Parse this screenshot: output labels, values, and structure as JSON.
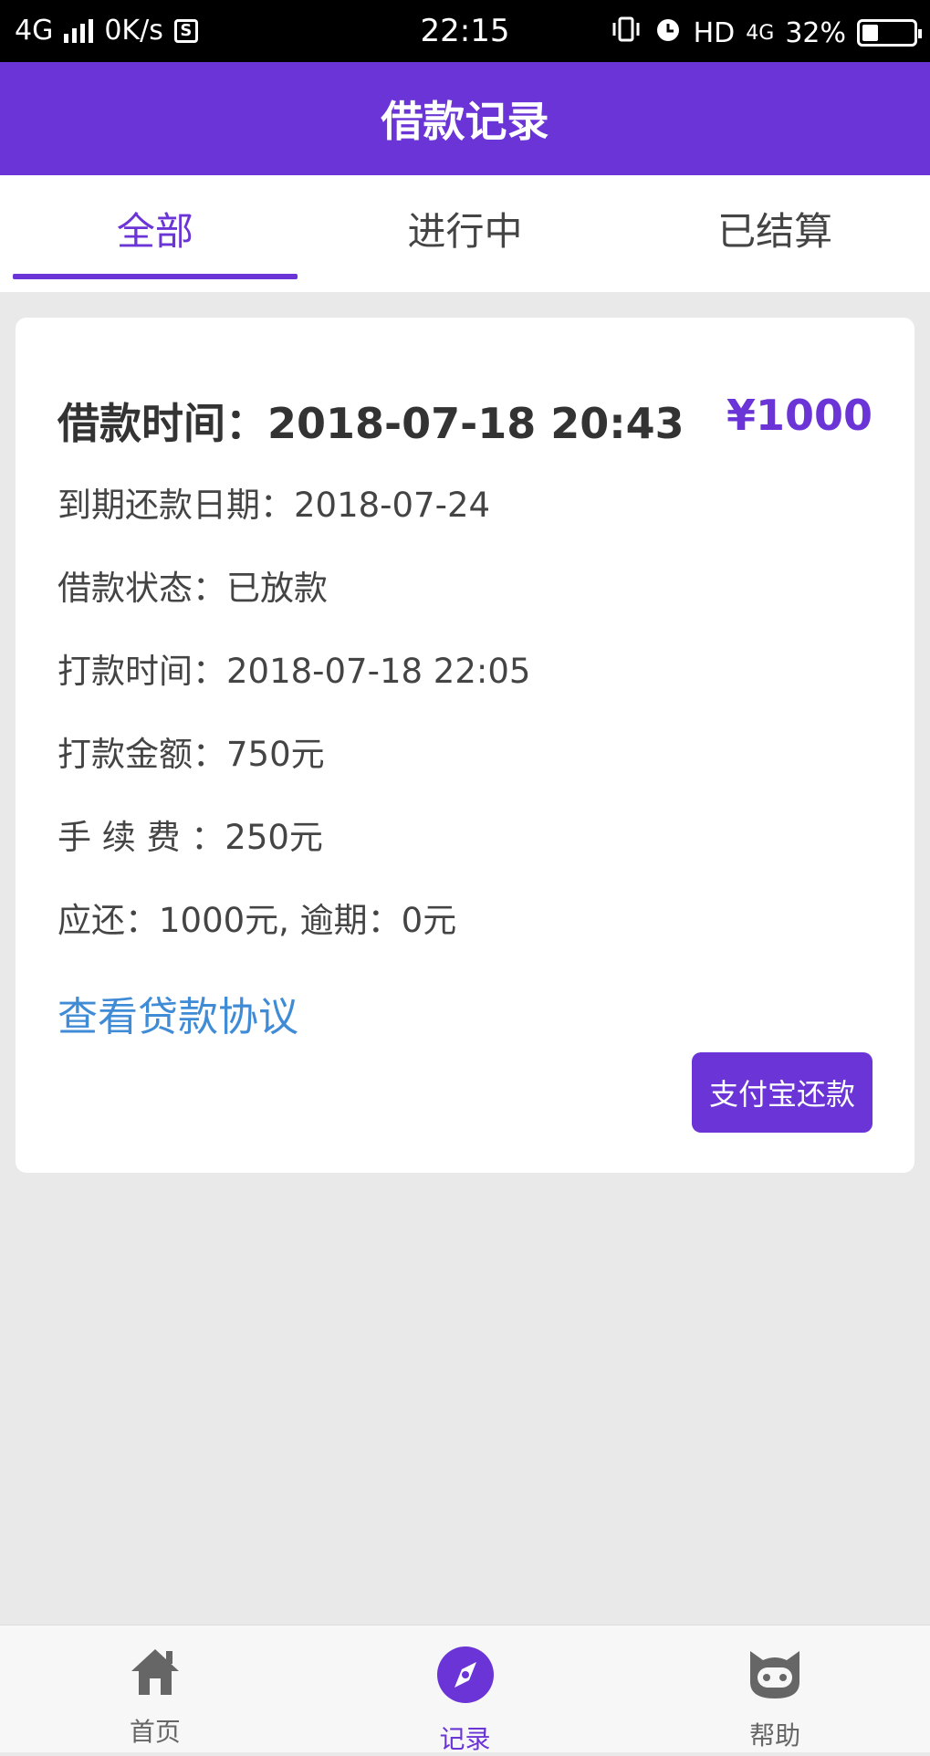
{
  "status_bar": {
    "network": "4G",
    "speed": "0K/s",
    "s_badge": "S",
    "time": "22:15",
    "hd": "HD",
    "network2": "4G",
    "battery": "32%",
    "battery_level": 0.32
  },
  "header": {
    "title": "借款记录"
  },
  "tabs": [
    {
      "label": "全部",
      "active": true
    },
    {
      "label": "进行中",
      "active": false
    },
    {
      "label": "已结算",
      "active": false
    }
  ],
  "record": {
    "borrow_time": "借款时间：2018-07-18 20:43",
    "amount": "¥1000",
    "due_date": "到期还款日期：2018-07-24",
    "status": "借款状态：已放款",
    "payout_time": "打款时间：2018-07-18 22:05",
    "payout_amount": "打款金额：750元",
    "fee": "手 续 费 ：250元",
    "repay": "应还：1000元, 逾期：0元",
    "agreement_link": "查看贷款协议",
    "pay_button": "支付宝还款"
  },
  "bottom_nav": [
    {
      "label": "首页",
      "icon": "home-icon",
      "active": false
    },
    {
      "label": "记录",
      "icon": "compass-icon",
      "active": true
    },
    {
      "label": "帮助",
      "icon": "help-cat-icon",
      "active": false
    }
  ],
  "colors": {
    "primary": "#6b34d6",
    "link": "#3f8bd6",
    "background": "#e9e9e9"
  }
}
